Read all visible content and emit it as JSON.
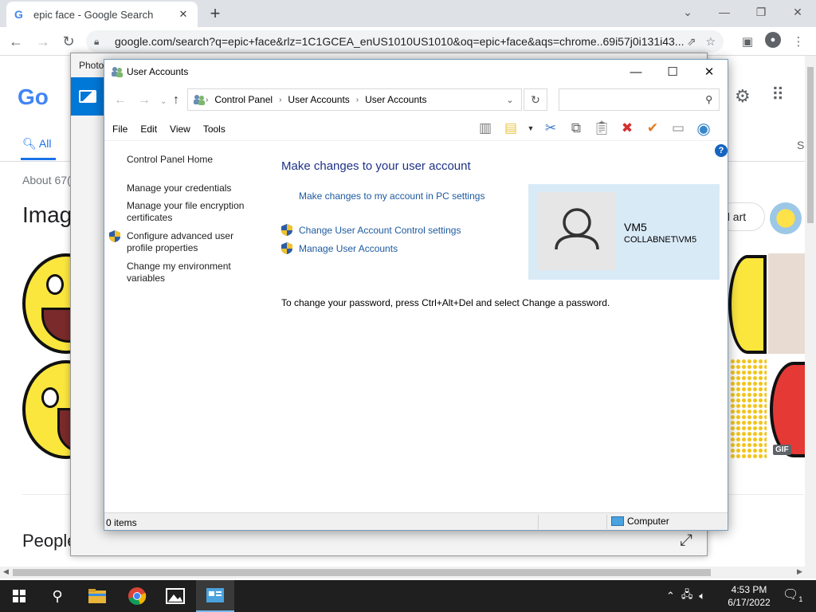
{
  "browser": {
    "tab_title": "epic face - Google Search",
    "url": "google.com/search?q=epic+face&rlz=1C1GCEA_enUS1010US1010&oq=epic+face&aqs=chrome..69i57j0i131i43...",
    "new_tab_label": "+"
  },
  "google": {
    "logo": "Go",
    "tab_all": "All",
    "tab_partial_right": "S",
    "about_partial": "About 67(",
    "images_heading_partial": "Imag",
    "chip_partial": "el art",
    "people_partial": "People",
    "gif_badge": "GIF"
  },
  "photos": {
    "title_partial": "Photo"
  },
  "user_accounts": {
    "title": "User Accounts",
    "breadcrumbs": [
      "Control Panel",
      "User Accounts",
      "User Accounts"
    ],
    "search_placeholder": "",
    "menu": [
      "File",
      "Edit",
      "View",
      "Tools"
    ],
    "left_links": {
      "home": "Control Panel Home",
      "credentials": "Manage your credentials",
      "encryption_line1": "Manage your file encryption",
      "encryption_line2": "certificates",
      "profile_line1": "Configure advanced user",
      "profile_line2": "profile properties",
      "env_line1": "Change my environment",
      "env_line2": "variables"
    },
    "heading": "Make changes to your user account",
    "link_pc_settings": "Make changes to my account in PC settings",
    "link_uac": "Change User Account Control settings",
    "link_manage": "Manage User Accounts",
    "password_note": "To change your password, press Ctrl+Alt+Del and select Change a password.",
    "user_name": "VM5",
    "user_domain": "COLLABNET\\VM5",
    "status_items": "0 items",
    "status_location": "Computer",
    "help_label": "?"
  },
  "taskbar": {
    "time": "4:53 PM",
    "date": "6/17/2022",
    "notification_count": "1"
  },
  "colors": {
    "link_blue": "#1e5aa0",
    "heading_blue": "#1e3287",
    "user_tile_bg": "#d9eaf7",
    "chrome_tabbar": "#dee1e6",
    "taskbar": "#1f1f1f"
  }
}
